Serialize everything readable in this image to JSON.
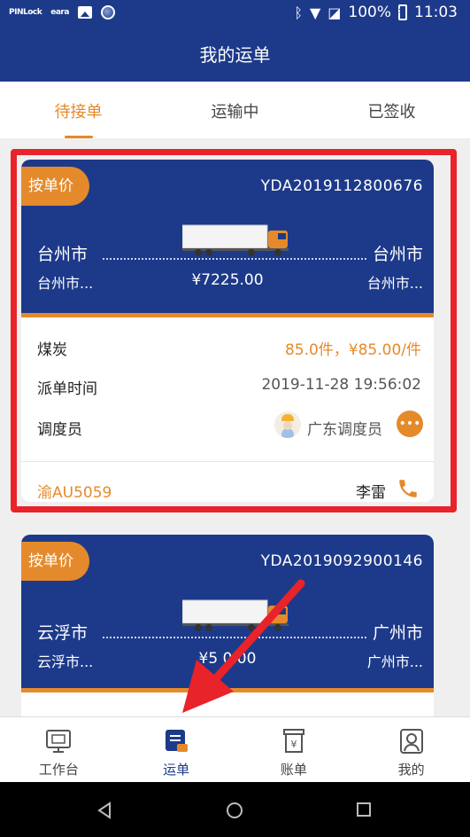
{
  "status_bar": {
    "left_labels": [
      "PINLock",
      "eara"
    ],
    "battery": "100%",
    "time": "11:03"
  },
  "header": {
    "title": "我的运单"
  },
  "tabs": [
    {
      "label": "待接单",
      "active": true
    },
    {
      "label": "运输中",
      "active": false
    },
    {
      "label": "已签收",
      "active": false
    }
  ],
  "orders": [
    {
      "badge": "按单价",
      "order_no": "YDA2019112800676",
      "from_city": "台州市",
      "from_sub": "台州市...",
      "to_city": "台州市",
      "to_sub": "台州市...",
      "price": "¥7225.00",
      "cargo_label": "煤炭",
      "cargo_value": "85.0件，¥85.00/件",
      "dispatch_time_label": "派单时间",
      "dispatch_time_value": "2019-11-28 19:56:02",
      "dispatcher_label": "调度员",
      "dispatcher_name": "广东调度员",
      "plate": "渝AU5059",
      "driver": "李雷"
    },
    {
      "badge": "按单价",
      "order_no": "YDA2019092900146",
      "from_city": "云浮市",
      "from_sub": "云浮市...",
      "to_city": "广州市",
      "to_sub": "广州市...",
      "price_visible": "¥5    0.00"
    }
  ],
  "bottom_nav": [
    {
      "label": "工作台",
      "icon": "monitor-icon",
      "active": false
    },
    {
      "label": "运单",
      "icon": "waybill-icon",
      "active": true
    },
    {
      "label": "账单",
      "icon": "bill-icon",
      "active": false
    },
    {
      "label": "我的",
      "icon": "profile-icon",
      "active": false
    }
  ],
  "colors": {
    "primary": "#1d3a8a",
    "accent": "#e58a2b",
    "highlight": "#e8232a"
  }
}
